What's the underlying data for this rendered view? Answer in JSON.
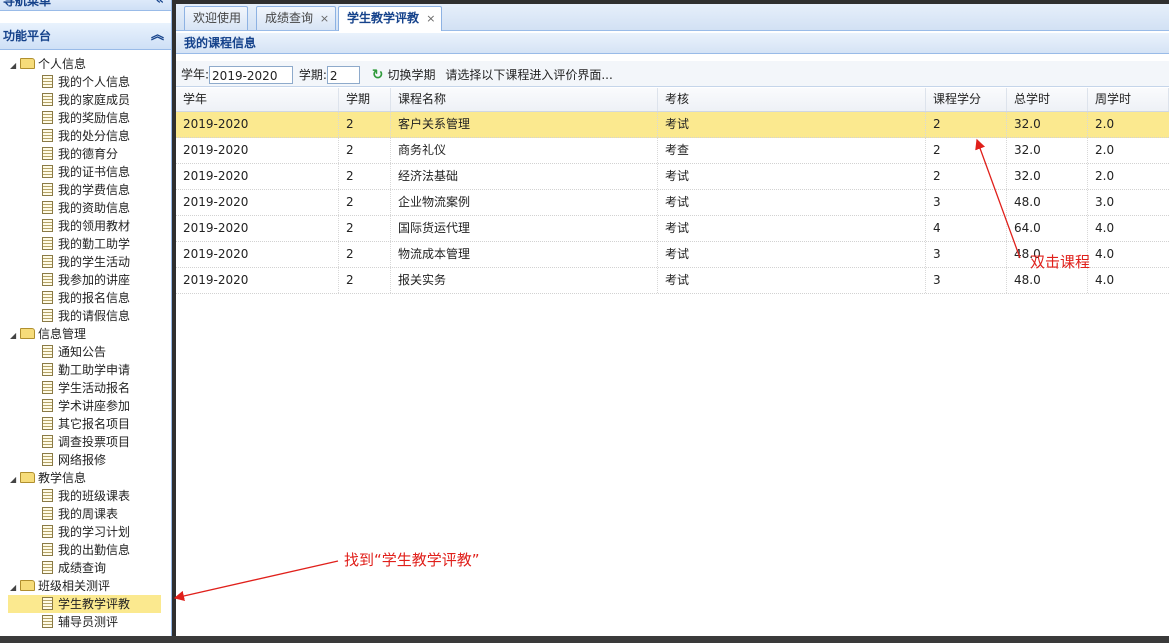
{
  "nav": {
    "header": "导航菜单",
    "collapse_icon": "double-chevron-left-icon",
    "platform": "功能平台",
    "platform_icon": "double-chevron-up-icon",
    "groups": [
      {
        "label": "个人信息",
        "items": [
          "我的个人信息",
          "我的家庭成员",
          "我的奖励信息",
          "我的处分信息",
          "我的德育分",
          "我的证书信息",
          "我的学费信息",
          "我的资助信息",
          "我的领用教材",
          "我的勤工助学",
          "我的学生活动",
          "我参加的讲座",
          "我的报名信息",
          "我的请假信息"
        ]
      },
      {
        "label": "信息管理",
        "items": [
          "通知公告",
          "勤工助学申请",
          "学生活动报名",
          "学术讲座参加",
          "其它报名项目",
          "调查投票项目",
          "网络报修"
        ]
      },
      {
        "label": "教学信息",
        "items": [
          "我的班级课表",
          "我的周课表",
          "我的学习计划",
          "我的出勤信息",
          "成绩查询"
        ]
      },
      {
        "label": "班级相关测评",
        "items": [
          "学生教学评教",
          "辅导员测评"
        ]
      }
    ],
    "selected_item": "学生教学评教"
  },
  "tabs": [
    {
      "label": "欢迎使用",
      "closable": false
    },
    {
      "label": "成绩查询",
      "closable": true
    },
    {
      "label": "学生教学评教",
      "closable": true,
      "active": true
    }
  ],
  "close_glyph": "×",
  "panel_title": "我的课程信息",
  "toolbar": {
    "year_label": "学年:",
    "year_value": "2019-2020",
    "term_label": "学期:",
    "term_value": "2",
    "switch_icon": "refresh-icon",
    "switch_label": "切换学期",
    "hint": "请选择以下课程进入评价界面..."
  },
  "grid": {
    "columns": [
      "学年",
      "学期",
      "课程名称",
      "考核",
      "课程学分",
      "总学时",
      "周学时"
    ],
    "rows": [
      [
        "2019-2020",
        "2",
        "客户关系管理",
        "考试",
        "2",
        "32.0",
        "2.0"
      ],
      [
        "2019-2020",
        "2",
        "商务礼仪",
        "考查",
        "2",
        "32.0",
        "2.0"
      ],
      [
        "2019-2020",
        "2",
        "经济法基础",
        "考试",
        "2",
        "32.0",
        "2.0"
      ],
      [
        "2019-2020",
        "2",
        "企业物流案例",
        "考试",
        "3",
        "48.0",
        "3.0"
      ],
      [
        "2019-2020",
        "2",
        "国际货运代理",
        "考试",
        "4",
        "64.0",
        "4.0"
      ],
      [
        "2019-2020",
        "2",
        "物流成本管理",
        "考试",
        "3",
        "48.0",
        "4.0"
      ],
      [
        "2019-2020",
        "2",
        "报关实务",
        "考试",
        "3",
        "48.0",
        "4.0"
      ]
    ],
    "selected_row": 0
  },
  "annotations": {
    "double_click": "双击课程",
    "find_item": "找到“学生教学评教”",
    "color": "#e0201b"
  }
}
